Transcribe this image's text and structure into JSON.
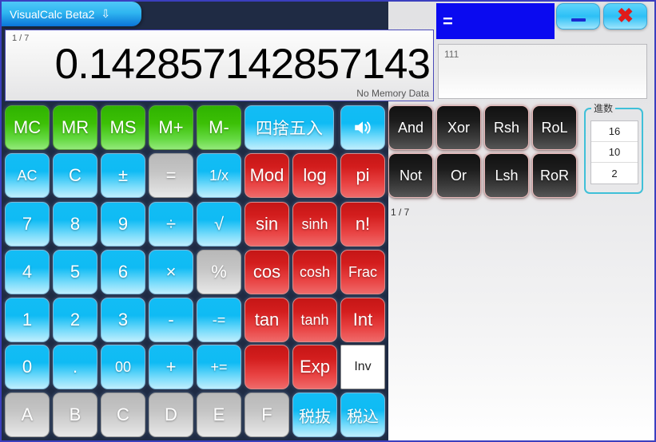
{
  "window": {
    "title": "VisualCalc Beta2",
    "title_arrow": "⇩",
    "minimize_label": "minimize",
    "close_label": "✖",
    "equals_indicator": "="
  },
  "display": {
    "page_indicator": "1 / 7",
    "value": "0.142857142857143",
    "memory_status": "No Memory Data"
  },
  "history": {
    "entry": "111"
  },
  "expression": {
    "text": "1 / 7"
  },
  "radix": {
    "title": "進数",
    "options": [
      "16",
      "10",
      "2"
    ]
  },
  "keypad": {
    "memory": [
      {
        "label": "MC",
        "name": "memory-clear"
      },
      {
        "label": "MR",
        "name": "memory-recall"
      },
      {
        "label": "MS",
        "name": "memory-store"
      },
      {
        "label": "M+",
        "name": "memory-add"
      },
      {
        "label": "M-",
        "name": "memory-subtract"
      }
    ],
    "row2": [
      {
        "label": "AC",
        "name": "all-clear"
      },
      {
        "label": "C",
        "name": "clear"
      },
      {
        "label": "±",
        "name": "sign-toggle"
      },
      {
        "label": "=",
        "name": "equals"
      },
      {
        "label": "1/x",
        "name": "reciprocal"
      }
    ],
    "row3": [
      {
        "label": "7",
        "name": "digit-7"
      },
      {
        "label": "8",
        "name": "digit-8"
      },
      {
        "label": "9",
        "name": "digit-9"
      },
      {
        "label": "÷",
        "name": "divide"
      },
      {
        "label": "√",
        "name": "square-root"
      }
    ],
    "row4": [
      {
        "label": "4",
        "name": "digit-4"
      },
      {
        "label": "5",
        "name": "digit-5"
      },
      {
        "label": "6",
        "name": "digit-6"
      },
      {
        "label": "×",
        "name": "multiply"
      },
      {
        "label": "%",
        "name": "percent"
      }
    ],
    "row5": [
      {
        "label": "1",
        "name": "digit-1"
      },
      {
        "label": "2",
        "name": "digit-2"
      },
      {
        "label": "3",
        "name": "digit-3"
      },
      {
        "label": "-",
        "name": "subtract"
      },
      {
        "label": "-=",
        "name": "subtract-equals"
      }
    ],
    "row6": [
      {
        "label": "0",
        "name": "digit-0"
      },
      {
        "label": ".",
        "name": "decimal-point"
      },
      {
        "label": "00",
        "name": "double-zero"
      },
      {
        "label": "+",
        "name": "add"
      },
      {
        "label": "+=",
        "name": "add-equals"
      }
    ],
    "hex": [
      {
        "label": "A",
        "name": "hex-a"
      },
      {
        "label": "B",
        "name": "hex-b"
      },
      {
        "label": "C",
        "name": "hex-c"
      },
      {
        "label": "D",
        "name": "hex-d"
      },
      {
        "label": "E",
        "name": "hex-e"
      },
      {
        "label": "F",
        "name": "hex-f"
      }
    ],
    "round_label": "四捨五入",
    "sound_label": "sound",
    "functions": [
      {
        "label": "Mod",
        "name": "modulo"
      },
      {
        "label": "log",
        "name": "logarithm"
      },
      {
        "label": "pi",
        "name": "pi"
      },
      {
        "label": "sin",
        "name": "sine"
      },
      {
        "label": "sinh",
        "name": "hyperbolic-sine"
      },
      {
        "label": "n!",
        "name": "factorial"
      },
      {
        "label": "cos",
        "name": "cosine"
      },
      {
        "label": "cosh",
        "name": "hyperbolic-cosine"
      },
      {
        "label": "Frac",
        "name": "fraction"
      },
      {
        "label": "tan",
        "name": "tangent"
      },
      {
        "label": "tanh",
        "name": "hyperbolic-tangent"
      },
      {
        "label": "Int",
        "name": "integer"
      }
    ],
    "blank_label": "",
    "exp_label": "Exp",
    "inv_label": "Inv",
    "tax_exclusive": "税抜",
    "tax_inclusive": "税込",
    "bitwise": [
      {
        "label": "And",
        "name": "bitwise-and"
      },
      {
        "label": "Xor",
        "name": "bitwise-xor"
      },
      {
        "label": "Rsh",
        "name": "right-shift"
      },
      {
        "label": "RoL",
        "name": "rotate-left"
      },
      {
        "label": "Not",
        "name": "bitwise-not"
      },
      {
        "label": "Or",
        "name": "bitwise-or"
      },
      {
        "label": "Lsh",
        "name": "left-shift"
      },
      {
        "label": "RoR",
        "name": "rotate-right"
      }
    ]
  },
  "colors": {
    "memory_green": "#3cc006",
    "keypad_cyan": "#0fbbf4",
    "function_red": "#d31d1d",
    "bitwise_black": "#1c1c1c",
    "hex_gray": "#c4c4c4",
    "accent_blue": "#0a0af0"
  }
}
